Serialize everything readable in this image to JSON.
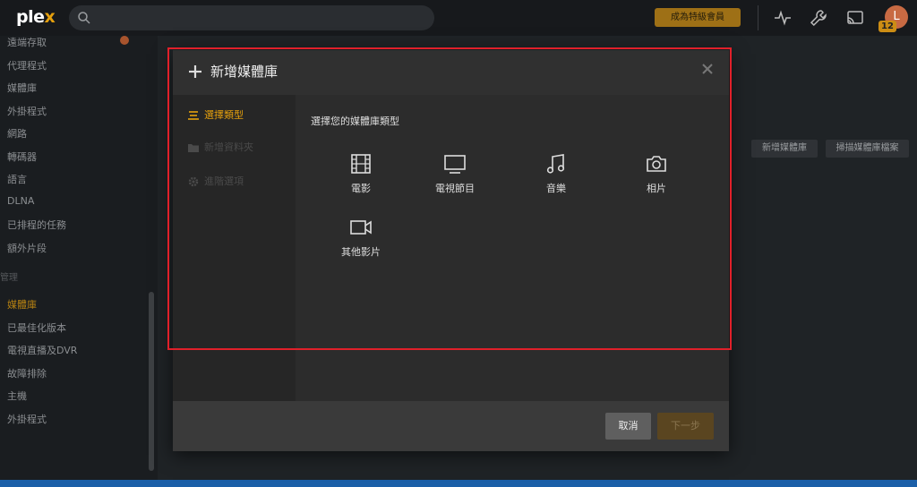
{
  "topbar": {
    "logo_prefix": "ple",
    "logo_suffix": "x",
    "search_placeholder": "",
    "premium_label": "成為特級會員",
    "avatar_initial": "L",
    "notification_count": "12"
  },
  "sidebar": {
    "items_top": [
      "遠端存取",
      "代理程式",
      "媒體庫",
      "外掛程式",
      "網路",
      "轉碼器",
      "語言",
      "DLNA",
      "已排程的任務",
      "額外片段"
    ],
    "section_label": "管理",
    "items_bottom": [
      "媒體庫",
      "已最佳化版本",
      "電視直播及DVR",
      "故障排除",
      "主機",
      "外掛程式"
    ]
  },
  "background": {
    "add_library_label": "新增媒體庫",
    "scan_library_label": "掃描媒體庫檔案"
  },
  "modal": {
    "title": "新增媒體庫",
    "steps": [
      {
        "label": "選擇類型",
        "state": "active"
      },
      {
        "label": "新增資料夾",
        "state": "disabled"
      },
      {
        "label": "進階選項",
        "state": "disabled"
      }
    ],
    "heading": "選擇您的媒體庫類型",
    "types": [
      {
        "label": "電影",
        "icon": "film-icon"
      },
      {
        "label": "電視節目",
        "icon": "tv-icon"
      },
      {
        "label": "音樂",
        "icon": "music-icon"
      },
      {
        "label": "相片",
        "icon": "camera-icon"
      },
      {
        "label": "其他影片",
        "icon": "video-camera-icon"
      }
    ],
    "cancel_label": "取消",
    "next_label": "下一步"
  },
  "colors": {
    "accent": "#e5a00d",
    "highlight": "#e0202a"
  }
}
